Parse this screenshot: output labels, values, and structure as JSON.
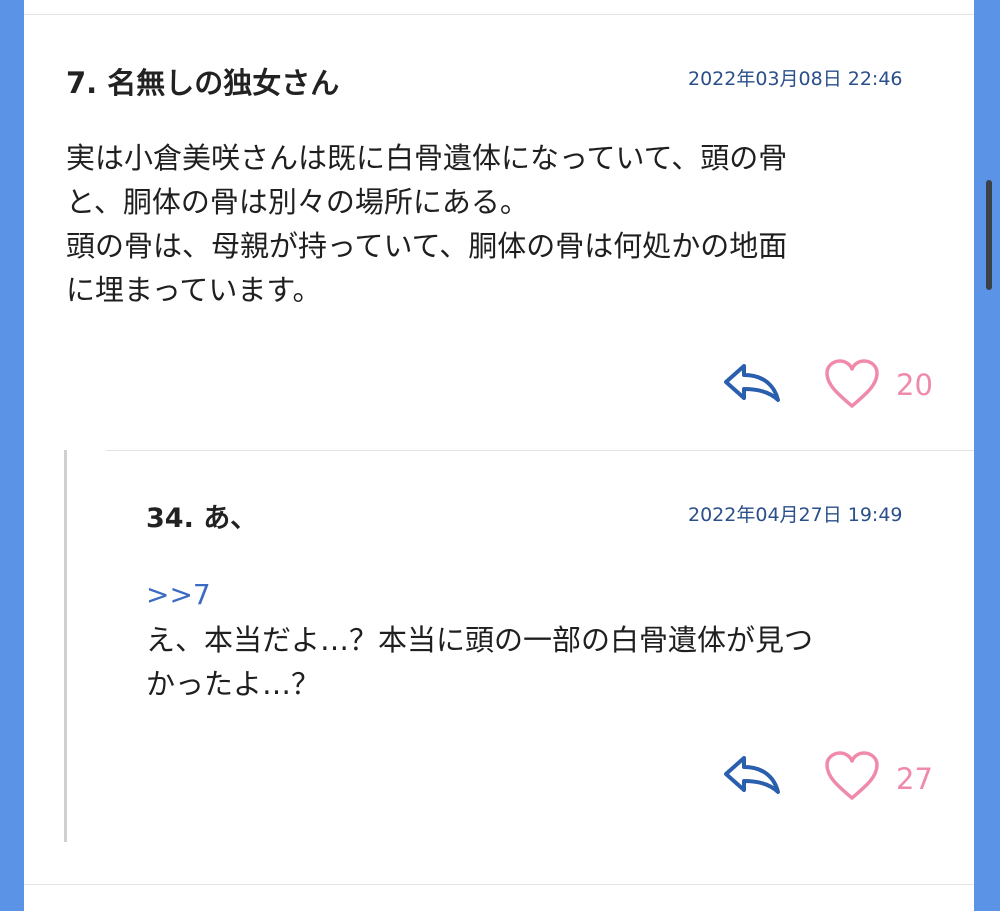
{
  "post": {
    "number_name": "7.  名無しの独女さん",
    "date": "2022年03月08日 22:46",
    "body": "実は小倉美咲さんは既に白骨遺体になっていて、頭の骨\nと、胴体の骨は別々の場所にある。\n頭の骨は、母親が持っていて、胴体の骨は何処かの地面\nに埋まっています。",
    "likes": "20"
  },
  "reply": {
    "number_name": "34.  あ、",
    "date": "2022年04月27日 19:49",
    "anchor": ">>7",
    "body": "え、本当だよ…？本当に頭の一部の白骨遺体が見つ\nかったよ…？",
    "likes": "27"
  },
  "colors": {
    "accent_blue": "#2a5fae",
    "like_pink": "#f08aaa",
    "background_blue": "#5b93e6"
  },
  "icons": {
    "reply": "reply-arrow-icon",
    "like": "heart-icon"
  }
}
